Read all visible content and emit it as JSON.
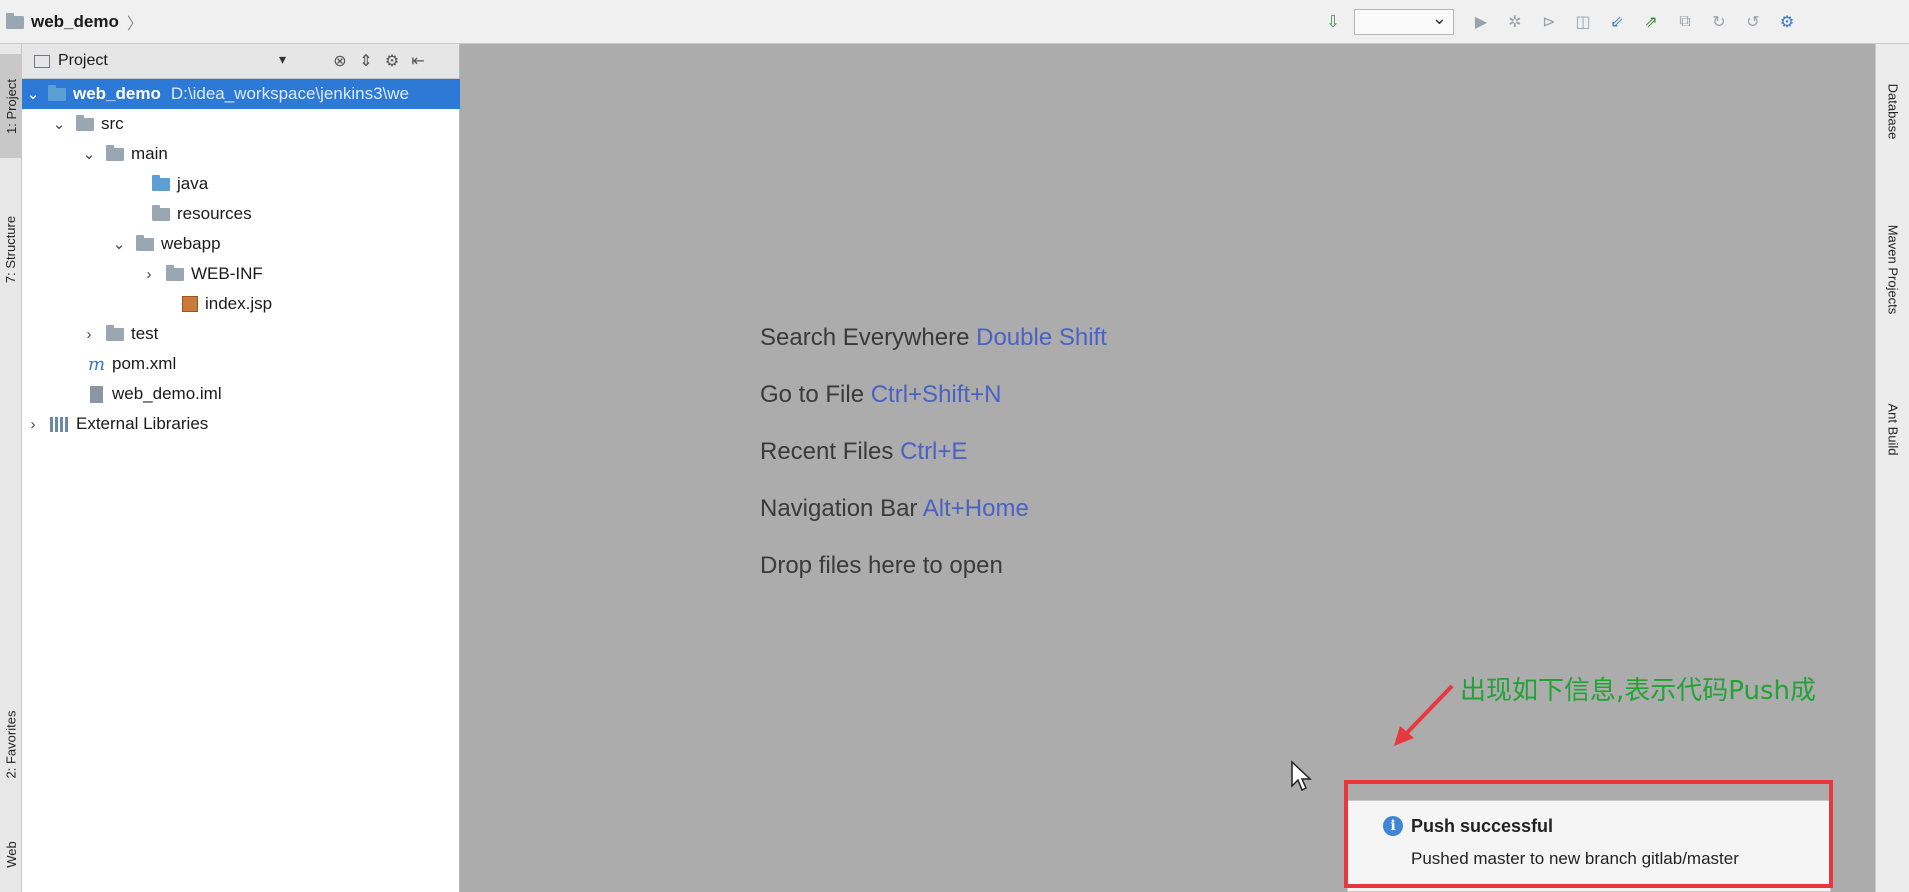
{
  "navbar": {
    "project": "web_demo"
  },
  "toolbar": {
    "icons": [
      "build-icon",
      "run-configuration-select",
      "run-icon",
      "debug-icon",
      "coverage-icon",
      "profile-icon",
      "vcs-update-icon",
      "vcs-commit-icon",
      "vcs-compare-icon",
      "vcs-history-icon",
      "vcs-revert-icon",
      "settings-icon"
    ]
  },
  "left_tabs": {
    "project": "1: Project",
    "structure": "7: Structure",
    "favorites": "2: Favorites",
    "web": "Web"
  },
  "right_tabs": {
    "database": "Database",
    "maven": "Maven Projects",
    "ant": "Ant Build"
  },
  "panel": {
    "title": "Project"
  },
  "tree": {
    "root_name": "web_demo",
    "root_path": "D:\\idea_workspace\\jenkins3\\we",
    "src": "src",
    "main": "main",
    "java": "java",
    "resources": "resources",
    "webapp": "webapp",
    "webinf": "WEB-INF",
    "indexjsp": "index.jsp",
    "test": "test",
    "pom": "pom.xml",
    "iml": "web_demo.iml",
    "external": "External Libraries"
  },
  "hints": {
    "search_label": "Search Everywhere",
    "search_key": "Double Shift",
    "goto_label": "Go to File",
    "goto_key": "Ctrl+Shift+N",
    "recent_label": "Recent Files",
    "recent_key": "Ctrl+E",
    "nav_label": "Navigation Bar",
    "nav_key": "Alt+Home",
    "drop_label": "Drop files here to open"
  },
  "annotation": {
    "text": "出现如下信息,表示代码Push成"
  },
  "notification": {
    "title": "Push successful",
    "body": "Pushed master to new branch gitlab/master"
  },
  "colors": {
    "selection": "#2c79d6",
    "editor_bg": "#acacac",
    "hint_key": "#4a62c4",
    "annotation": "#21a336",
    "highlight_box": "#e8383d"
  }
}
